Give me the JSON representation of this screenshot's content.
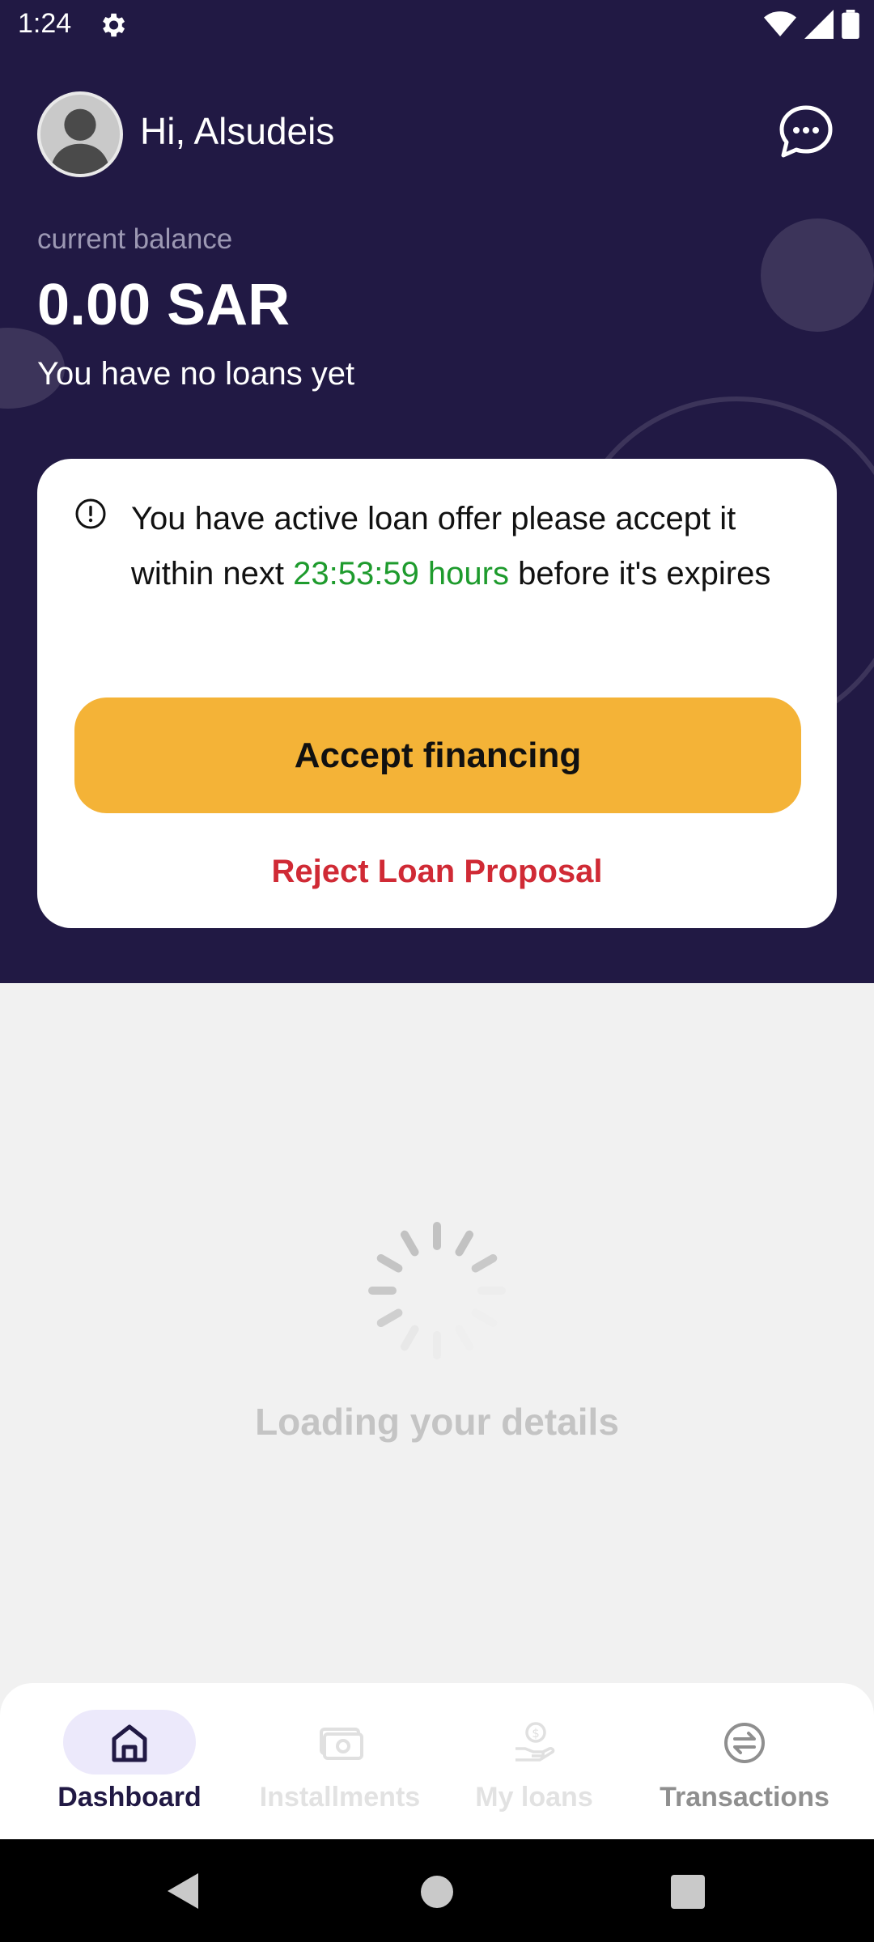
{
  "status_bar": {
    "time": "1:24",
    "icons": [
      "gear-icon",
      "wifi-icon",
      "signal-icon",
      "battery-icon"
    ]
  },
  "header": {
    "greeting": "Hi, Alsudeis",
    "chat_icon": "chat-bubble-icon"
  },
  "balance": {
    "label": "current balance",
    "value": "0.00 SAR",
    "loans_status": "You have no loans yet"
  },
  "offer_card": {
    "icon": "info-icon",
    "text_before": "You have active loan offer please accept it within next ",
    "timer": "23:53:59 hours",
    "text_after": " before it's expires",
    "accept_label": "Accept financing",
    "reject_label": "Reject Loan Proposal"
  },
  "loading": {
    "text": "Loading your details"
  },
  "bottom_nav": {
    "items": [
      {
        "label": "Dashboard",
        "icon": "home-icon",
        "active": true
      },
      {
        "label": "Installments",
        "icon": "cash-icon",
        "active": false
      },
      {
        "label": "My loans",
        "icon": "hand-coin-icon",
        "active": false
      },
      {
        "label": "Transactions",
        "icon": "transfer-icon",
        "active": false
      }
    ]
  },
  "colors": {
    "header_bg": "#211944",
    "accent": "#f4b337",
    "reject": "#d02a35",
    "timer": "#1e9b2d",
    "nav_active_pill": "#ece9fb"
  }
}
